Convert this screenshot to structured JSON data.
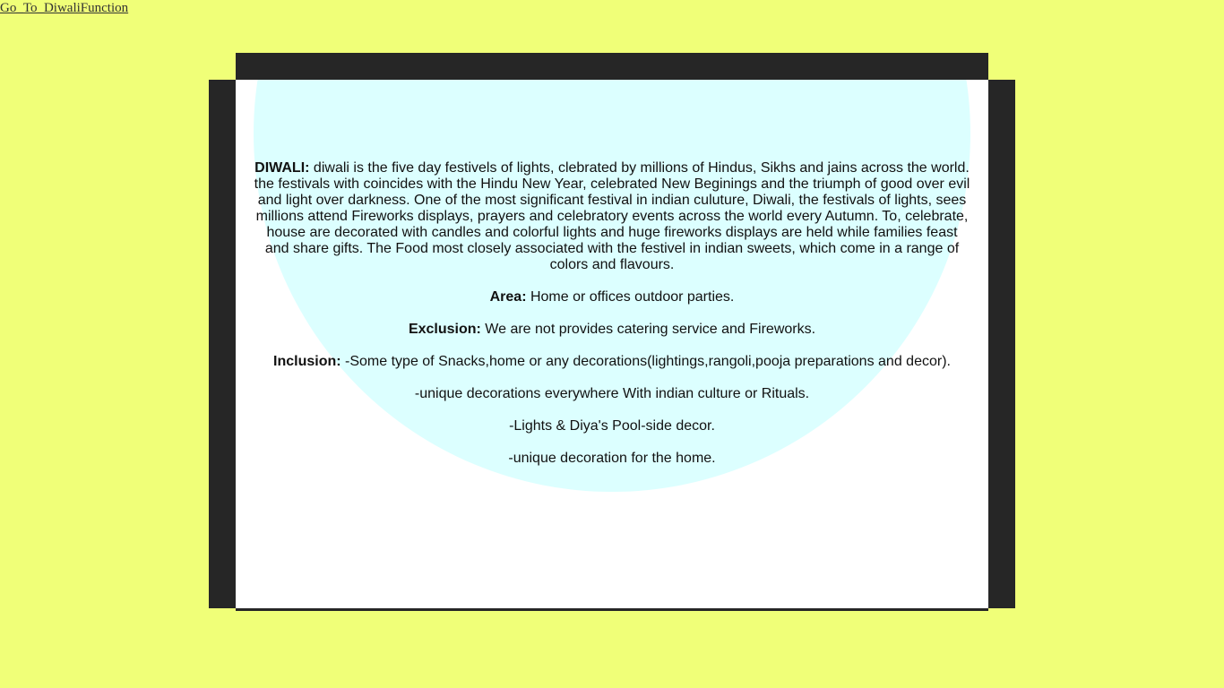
{
  "link": {
    "label": "Go_To_DiwaliFunction"
  },
  "content": {
    "diwali_label": "DIWALI:",
    "diwali_text": " diwali is the five day festivels of lights, clebrated by millions of Hindus, Sikhs and jains across the world. the festivals with coincides with the Hindu New Year, celebrated New Beginings and the triumph of good over evil and light over darkness. One of the most significant festival in indian culuture, Diwali, the festivals of lights, sees millions attend Fireworks displays, prayers and celebratory events across the world every Autumn. To, celebrate, house are decorated with candles and colorful lights and huge fireworks displays are held while families feast and share gifts. The Food most closely associated with the festivel in indian sweets, which come in a range of colors and flavours.",
    "area_label": "Area:",
    "area_text": " Home or offices outdoor parties.",
    "exclusion_label": "Exclusion:",
    "exclusion_text": " We are not provides catering service and Fireworks.",
    "inclusion_label": "Inclusion:",
    "inclusion_text": " -Some type of Snacks,home or any decorations(lightings,rangoli,pooja preparations and decor).",
    "inclusion_items": [
      "-unique decorations everywhere With indian culture or Rituals.",
      "-Lights & Diya's Pool-side decor.",
      "-unique decoration for the home."
    ]
  },
  "colors": {
    "background": "#f0ff78",
    "frame": "#262626",
    "panel": "#ffffff",
    "circle": "#dcffff"
  }
}
